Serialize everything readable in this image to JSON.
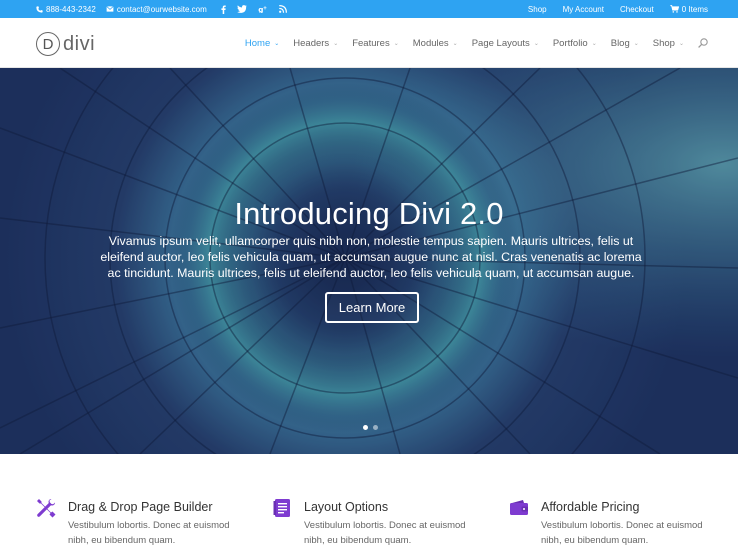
{
  "topbar": {
    "phone": "888-443-2342",
    "email": "contact@ourwebsite.com",
    "social_icons": [
      "facebook-icon",
      "twitter-icon",
      "google-plus-icon",
      "rss-icon"
    ],
    "links": [
      {
        "label": "Shop"
      },
      {
        "label": "My Account"
      },
      {
        "label": "Checkout"
      },
      {
        "label": "0 Items"
      }
    ],
    "color": "#2ea3f2"
  },
  "header": {
    "logo_letter": "D",
    "logo_text": "divi",
    "nav": [
      {
        "label": "Home",
        "active": true
      },
      {
        "label": "Headers"
      },
      {
        "label": "Features"
      },
      {
        "label": "Modules"
      },
      {
        "label": "Page Layouts"
      },
      {
        "label": "Portfolio"
      },
      {
        "label": "Blog"
      },
      {
        "label": "Shop"
      }
    ],
    "caret": "⌄"
  },
  "hero": {
    "title": "Introducing Divi 2.0",
    "description": "Vivamus ipsum velit, ullamcorper quis nibh non, molestie tempus sapien. Mauris ultrices, felis ut eleifend auctor, leo felis vehicula quam, ut accumsan augue nunc at nisl. Cras venenatis ac lorema ac tincidunt. Mauris ultrices, felis ut eleifend auctor, leo felis vehicula quam, ut accumsan augue.",
    "button_label": "Learn More",
    "slide_count": 2,
    "active_slide": 1
  },
  "features": [
    {
      "icon": "tools-icon",
      "title": "Drag & Drop Page Builder",
      "description": "Vestibulum lobortis. Donec at euismod nibh, eu bibendum quam."
    },
    {
      "icon": "document-icon",
      "title": "Layout Options",
      "description": "Vestibulum lobortis. Donec at euismod nibh, eu bibendum quam."
    },
    {
      "icon": "wallet-icon",
      "title": "Affordable Pricing",
      "description": "Vestibulum lobortis. Donec at euismod nibh, eu bibendum quam."
    }
  ],
  "accent_color": "#7e3bd0"
}
